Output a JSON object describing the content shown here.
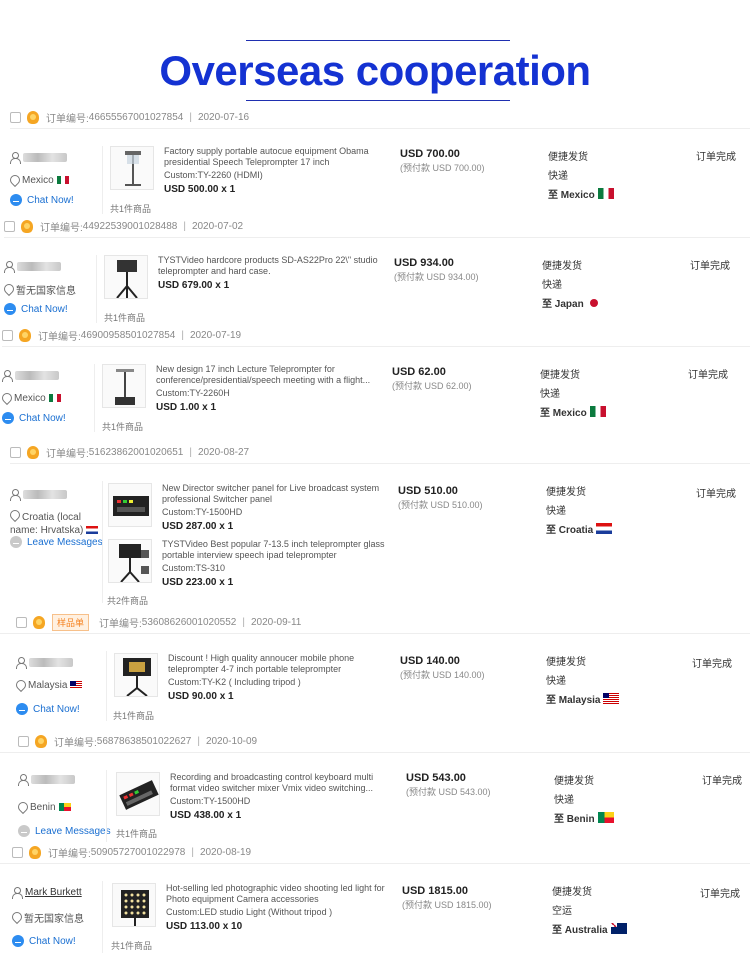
{
  "title": "Overseas cooperation",
  "order_no_label": "订单编号:",
  "product_count_1": "共1件商品",
  "product_count_2": "共2件商品",
  "shipping_method": "便捷发货",
  "status_label": "订单完成",
  "sample_badge": "样品单",
  "orders": [
    {
      "order_id": "46655567001027854",
      "date": "2020-07-16",
      "buyer_location": "Mexico",
      "contact": "Chat Now!",
      "product": {
        "title": "Factory supply portable autocue equipment Obama presidential Speech Teleprompter 17 inch",
        "custom": "Custom:TY-2260 (HDMI)",
        "price_qty": "USD 500.00 x 1"
      },
      "total": "USD 700.00",
      "prepaid": "(预付款 USD 700.00)",
      "carrier": "快递",
      "destination": "至 Mexico"
    },
    {
      "order_id": "44922539001028488",
      "date": "2020-07-02",
      "buyer_location": "暂无国家信息",
      "contact": "Chat Now!",
      "product": {
        "title": "TYSTVideo hardcore products SD-AS22Pro 22\\\" studio teleprompter and hard case.",
        "custom": "",
        "price_qty": "USD 679.00 x 1"
      },
      "total": "USD 934.00",
      "prepaid": "(预付款 USD 934.00)",
      "carrier": "快递",
      "destination": "至 Japan"
    },
    {
      "order_id": "46900958501027854",
      "date": "2020-07-19",
      "buyer_location": "Mexico",
      "contact": "Chat Now!",
      "product": {
        "title": "New design 17 inch Lecture Teleprompter for conference/presidential/speech meeting with a flight...",
        "custom": "Custom:TY-2260H",
        "price_qty": "USD 1.00 x 1"
      },
      "total": "USD 62.00",
      "prepaid": "(预付款 USD 62.00)",
      "carrier": "快递",
      "destination": "至 Mexico"
    },
    {
      "order_id": "51623862001020651",
      "date": "2020-08-27",
      "buyer_location": "Croatia (local name: Hrvatska)",
      "contact": "Leave Messages",
      "product": {
        "title": "New Director switcher panel for Live broadcast system professional Switcher panel",
        "custom": "Custom:TY-1500HD",
        "price_qty": "USD 287.00 x 1"
      },
      "product2": {
        "title": "TYSTVideo Best popular 7-13.5 inch teleprompter glass portable interview speech ipad teleprompter",
        "custom": "Custom:TS-310",
        "price_qty": "USD 223.00 x 1"
      },
      "total": "USD 510.00",
      "prepaid": "(预付款 USD 510.00)",
      "carrier": "快递",
      "destination": "至 Croatia"
    },
    {
      "order_id": "53608626001020552",
      "date": "2020-09-11",
      "buyer_location": "Malaysia",
      "contact": "Chat Now!",
      "product": {
        "title": "Discount ! High quality annoucer mobile phone teleprompter 4-7 inch portable teleprompter",
        "custom": "Custom:TY-K2 ( Including tripod )",
        "price_qty": "USD 90.00 x 1"
      },
      "total": "USD 140.00",
      "prepaid": "(预付款 USD 140.00)",
      "carrier": "快递",
      "destination": "至 Malaysia"
    },
    {
      "order_id": "56878638501022627",
      "date": "2020-10-09",
      "buyer_location": "Benin",
      "contact": "Leave Messages",
      "product": {
        "title": "Recording and broadcasting control keyboard multi format video switcher mixer Vmix video switching...",
        "custom": "Custom:TY-1500HD",
        "price_qty": "USD 438.00 x 1"
      },
      "total": "USD 543.00",
      "prepaid": "(预付款 USD 543.00)",
      "carrier": "快递",
      "destination": "至 Benin"
    },
    {
      "order_id": "50905727001022978",
      "date": "2020-08-19",
      "buyer_name": "Mark Burkett",
      "buyer_location": "暂无国家信息",
      "contact": "Chat Now!",
      "product": {
        "title": "Hot-selling led photographic video shooting led light for Photo equipment Camera accessories",
        "custom": "Custom:LED studio Light (Without tripod )",
        "price_qty": "USD 113.00 x 10"
      },
      "total": "USD 1815.00",
      "prepaid": "(预付款 USD 1815.00)",
      "carrier": "空运",
      "destination": "至 Australia"
    }
  ]
}
